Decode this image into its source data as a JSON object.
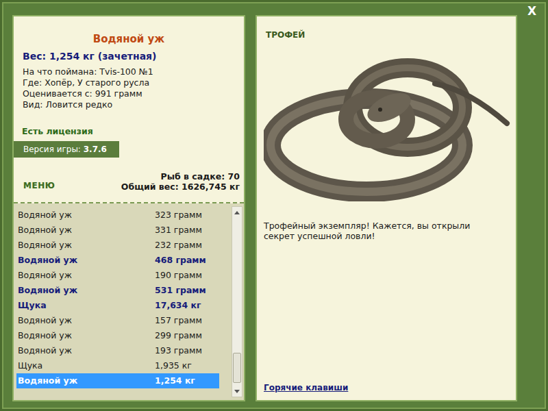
{
  "close": "X",
  "fish": {
    "title": "Водяной уж",
    "weight": "Вес: 1,254 кг (зачетная)",
    "details": [
      "На что поймана: Tvis-100 №1",
      "Где: Хопёр, У старого русла",
      "Оценивается с: 991 грамм",
      "Вид: Ловится редко"
    ],
    "license": "Есть лицензия"
  },
  "version": {
    "label": "Версия игры:",
    "value": "3.7.6"
  },
  "menu": "МЕНЮ",
  "keepnet": {
    "count": "Рыб в садке: 70",
    "total": "Общий вес: 1626,745 кг"
  },
  "catch_list": [
    {
      "name": "Водяной уж",
      "weight": "323 грамм",
      "trophy": false,
      "selected": false
    },
    {
      "name": "Водяной уж",
      "weight": "331 грамм",
      "trophy": false,
      "selected": false
    },
    {
      "name": "Водяной уж",
      "weight": "232 грамм",
      "trophy": false,
      "selected": false
    },
    {
      "name": "Водяной уж",
      "weight": "468 грамм",
      "trophy": true,
      "selected": false
    },
    {
      "name": "Водяной уж",
      "weight": "190 грамм",
      "trophy": false,
      "selected": false
    },
    {
      "name": "Водяной уж",
      "weight": "531 грамм",
      "trophy": true,
      "selected": false
    },
    {
      "name": "Щука",
      "weight": "17,634 кг",
      "trophy": true,
      "selected": false
    },
    {
      "name": "Водяной уж",
      "weight": "157 грамм",
      "trophy": false,
      "selected": false
    },
    {
      "name": "Водяной уж",
      "weight": "299 грамм",
      "trophy": false,
      "selected": false
    },
    {
      "name": "Водяной уж",
      "weight": "193 грамм",
      "trophy": false,
      "selected": false
    },
    {
      "name": "Щука",
      "weight": "1,935 кг",
      "trophy": false,
      "selected": false
    },
    {
      "name": "Водяной уж",
      "weight": "1,254 кг",
      "trophy": true,
      "selected": true
    }
  ],
  "trophy": {
    "label": "ТРОФЕЙ",
    "message": "Трофейный экземпляр! Кажется, вы открыли секрет успешной ловли!",
    "hotkeys": "Горячие клавиши"
  }
}
